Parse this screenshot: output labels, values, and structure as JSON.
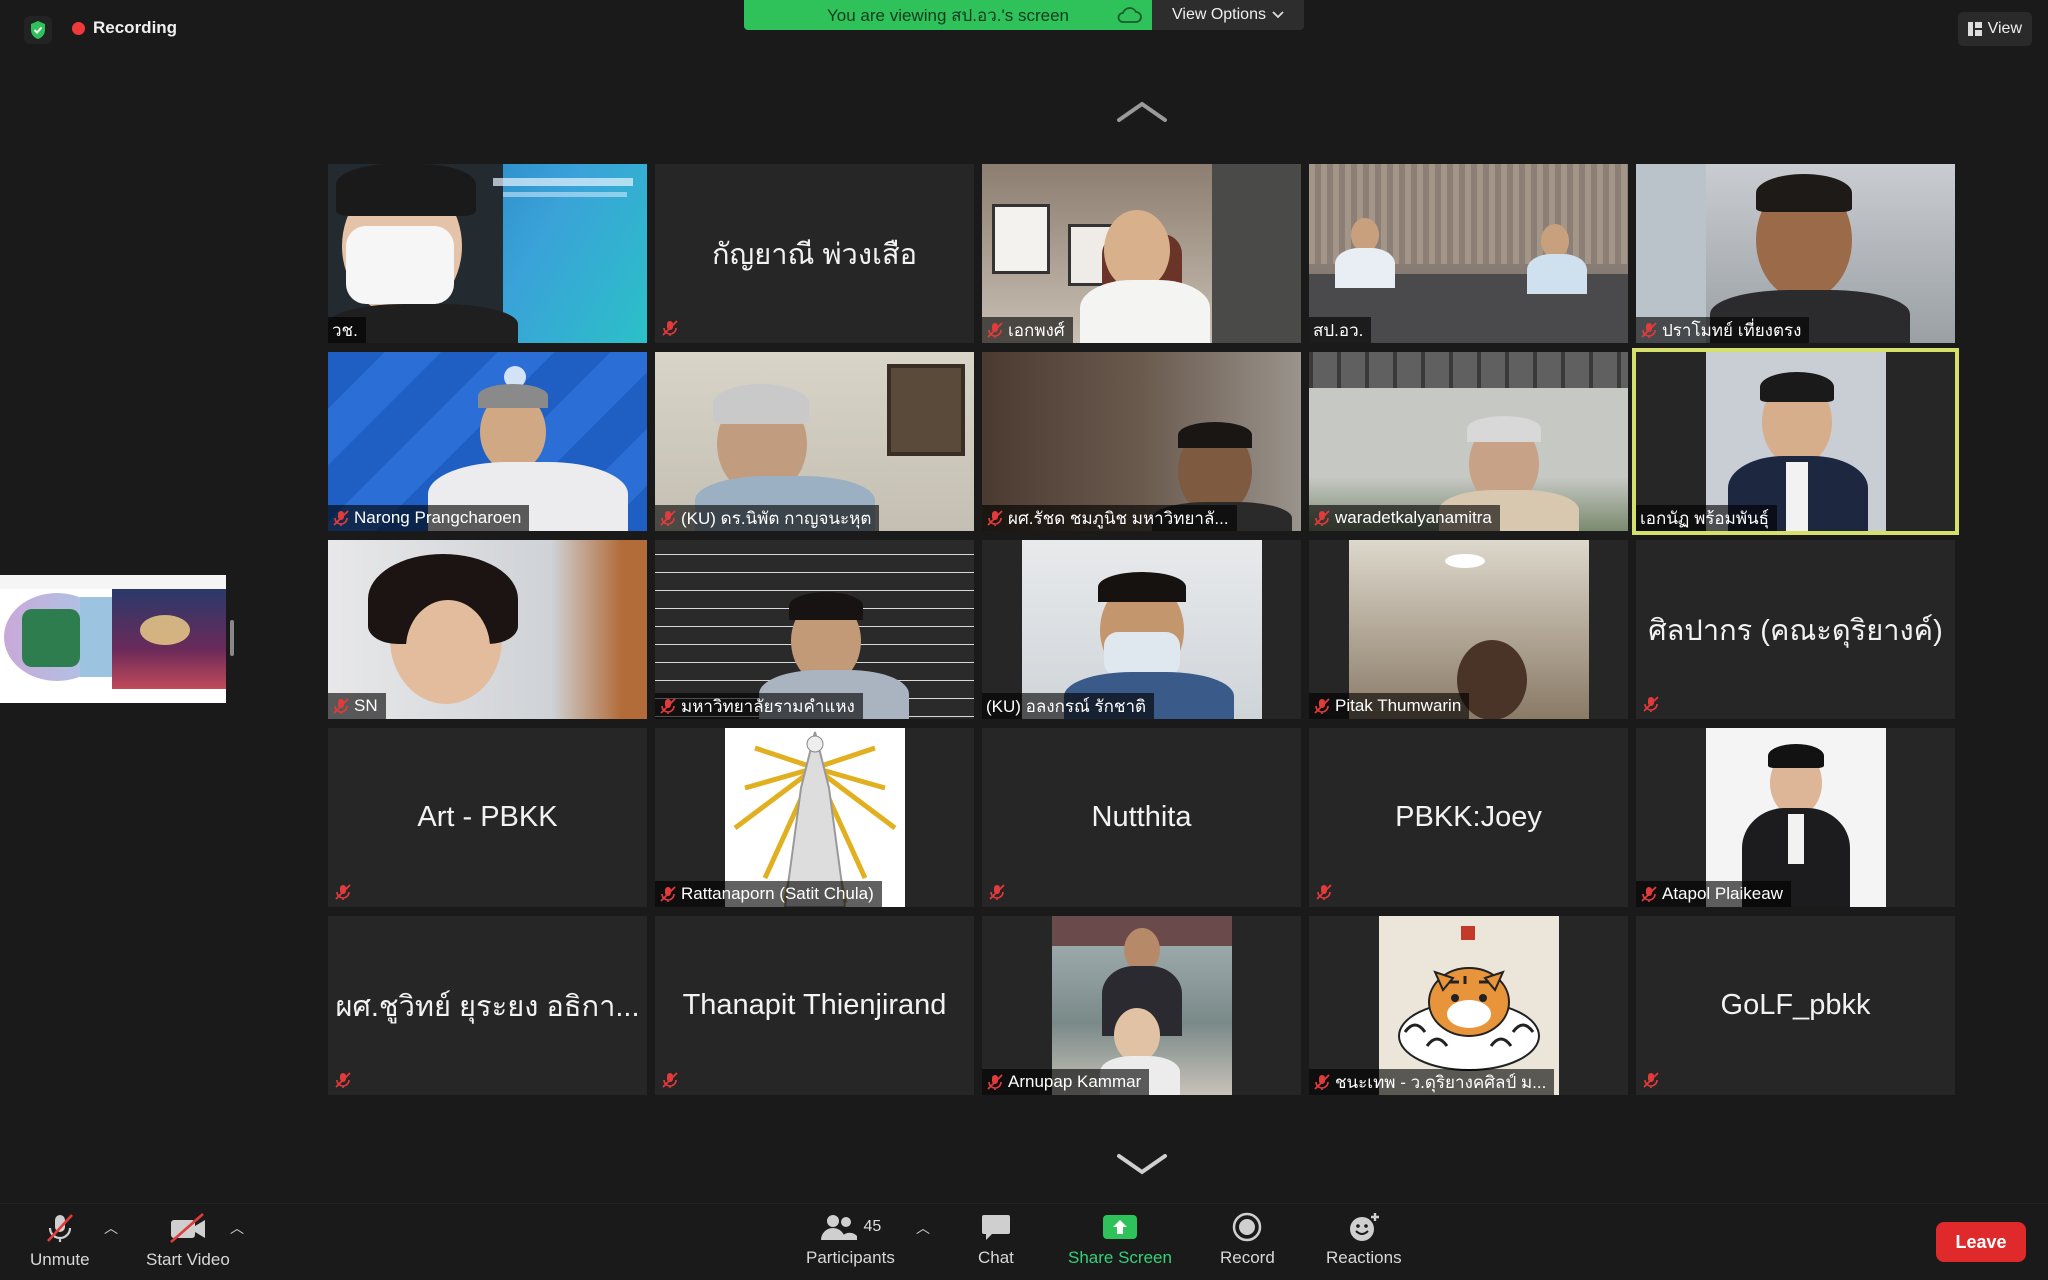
{
  "top": {
    "recording_label": "Recording",
    "banner_text": "You are viewing สป.อว.'s screen",
    "view_options_label": "View Options",
    "view_label": "View"
  },
  "colors": {
    "recording_dot": "#f03a3a",
    "banner_green": "#2fc15a",
    "leave_red": "#e0292b",
    "active_speaker_outline": "#d4e06a",
    "share_screen_green": "#33d17a"
  },
  "tiles": [
    {
      "name": "วช.",
      "muted": false,
      "video": true
    },
    {
      "name": "กัญยาณี พ่วงเสือ",
      "muted": true,
      "video": false
    },
    {
      "name": "เอกพงศ์",
      "muted": true,
      "video": true
    },
    {
      "name": "สป.อว.",
      "muted": false,
      "video": true
    },
    {
      "name": "ปราโมทย์ เที่ยงตรง",
      "muted": true,
      "video": true
    },
    {
      "name": "Narong Prangcharoen",
      "muted": true,
      "video": true
    },
    {
      "name": "(KU) ดร.นิพัต กาญจนะหุต",
      "muted": true,
      "video": true
    },
    {
      "name": "ผศ.รัชด ชมภูนิช มหาวิทยาลั...",
      "muted": true,
      "video": true
    },
    {
      "name": "waradetkalyanamitra",
      "muted": true,
      "video": true
    },
    {
      "name": "เอกนัฏ พร้อมพันธุ์",
      "muted": false,
      "video": true,
      "active": true
    },
    {
      "name": "SN",
      "muted": true,
      "video": true
    },
    {
      "name": "มหาวิทยาลัยรามคำแหง",
      "muted": true,
      "video": true
    },
    {
      "name": "(KU) อลงกรณ์ รักชาติ",
      "muted": false,
      "video": true
    },
    {
      "name": "Pitak Thumwarin",
      "muted": true,
      "video": true
    },
    {
      "name": "ศิลปากร (คณะดุริยางค์)",
      "muted": true,
      "video": false
    },
    {
      "name": "Art - PBKK",
      "muted": true,
      "video": false
    },
    {
      "name": "Rattanaporn (Satit Chula)",
      "muted": true,
      "video": true
    },
    {
      "name": "Nutthita",
      "muted": true,
      "video": false
    },
    {
      "name": "PBKK:Joey",
      "muted": true,
      "video": false
    },
    {
      "name": "Atapol Plaikeaw",
      "muted": true,
      "video": true
    },
    {
      "name": "ผศ.ชูวิทย์ ยุระยง อธิกา...",
      "muted": true,
      "video": false
    },
    {
      "name": "Thanapit Thienjirand",
      "muted": true,
      "video": false
    },
    {
      "name": "Arnupap Kammar",
      "muted": true,
      "video": true
    },
    {
      "name": "ชนะเทพ - ว.ดุริยางคศิลป์ ม...",
      "muted": true,
      "video": true
    },
    {
      "name": "GoLF_pbkk",
      "muted": true,
      "video": false
    }
  ],
  "toolbar": {
    "unmute_label": "Unmute",
    "start_video_label": "Start Video",
    "participants_label": "Participants",
    "participants_count": "45",
    "chat_label": "Chat",
    "share_screen_label": "Share Screen",
    "record_label": "Record",
    "reactions_label": "Reactions",
    "leave_label": "Leave"
  },
  "icons": [
    "shield-icon",
    "cloud-icon",
    "chevron-down-icon",
    "view-layout-icon",
    "scroll-up-icon",
    "scroll-down-icon",
    "mic-off-icon",
    "video-off-icon",
    "participants-icon",
    "chat-icon",
    "share-screen-icon",
    "record-icon",
    "reactions-icon"
  ]
}
